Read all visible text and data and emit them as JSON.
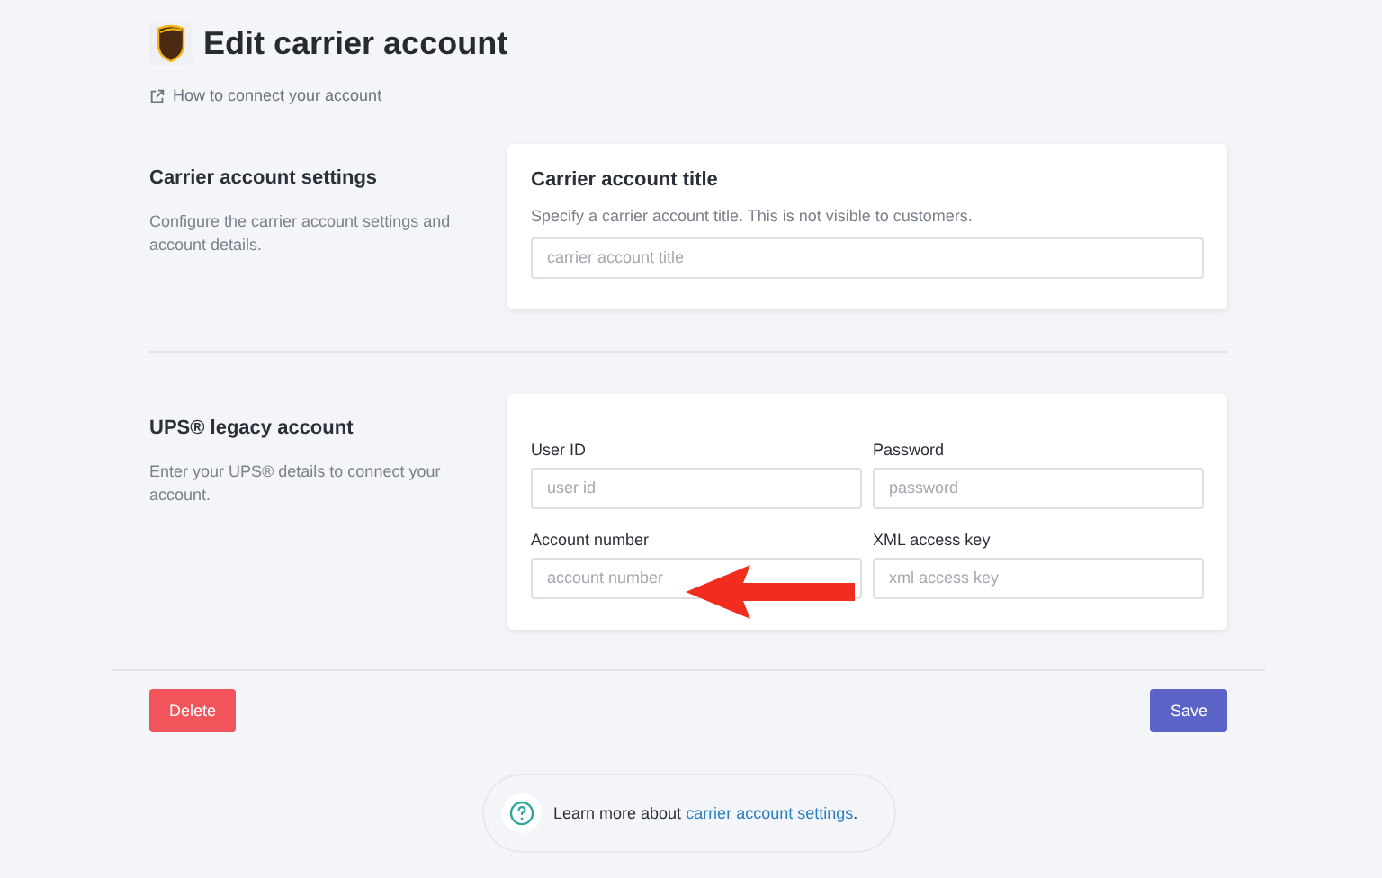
{
  "header": {
    "title": "Edit carrier account",
    "help_link": "How to connect your account"
  },
  "sections": [
    {
      "title": "Carrier account settings",
      "description": "Configure the carrier account settings and account details.",
      "card_title": "Carrier account title",
      "card_hint": "Specify a carrier account title. This is not visible to customers.",
      "fields": [
        {
          "placeholder": "carrier account title",
          "wide": true
        }
      ]
    },
    {
      "title": "UPS® legacy account",
      "description": "Enter your UPS® details to connect your account.",
      "fields": [
        {
          "label": "User ID",
          "placeholder": "user id",
          "wide": false
        },
        {
          "label": "Password",
          "placeholder": "password",
          "wide": false
        },
        {
          "label": "Account number",
          "placeholder": "account number",
          "wide": false,
          "annotated": true
        },
        {
          "label": "XML access key",
          "placeholder": "xml access key",
          "wide": false
        }
      ]
    }
  ],
  "actions": {
    "delete": "Delete",
    "save": "Save"
  },
  "footer": {
    "text": "Learn more about",
    "link": "carrier account settings",
    "after": "."
  }
}
